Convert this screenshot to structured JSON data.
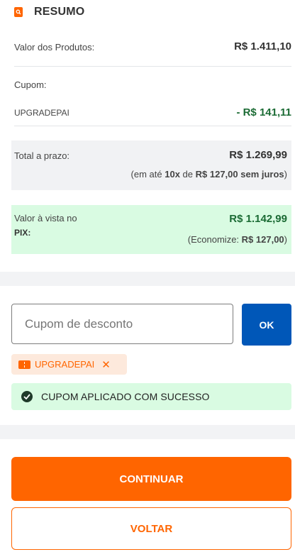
{
  "summary": {
    "title": "RESUMO",
    "icon": "search-receipt-icon",
    "products_label": "Valor dos Produtos:",
    "products_value": "R$ 1.411,10",
    "coupon_label": "Cupom:",
    "coupon_code": "UPGRADEPAI",
    "coupon_discount": "- R$ 141,11",
    "total_label": "Total a prazo:",
    "total_value": "R$ 1.269,99",
    "installments": {
      "prefix": "(em até ",
      "count": "10x",
      "mid": " de ",
      "amount": "R$ 127,00 sem juros",
      "suffix": ")"
    },
    "pix_label": "Valor à vista no",
    "pix_label_strong": "PIX:",
    "pix_value": "R$ 1.142,99",
    "savings": {
      "prefix": "(Economize: ",
      "amount": "R$ 127,00",
      "suffix": ")"
    }
  },
  "coupon": {
    "placeholder": "Cupom de desconto",
    "ok_label": "OK",
    "applied_code": "UPGRADEPAI",
    "remove_symbol": "✕",
    "success_message": "CUPOM APLICADO COM SUCESSO"
  },
  "actions": {
    "continue_label": "CONTINUAR",
    "back_label": "VOLTAR"
  },
  "colors": {
    "accent": "#ff6500",
    "primary_blue": "#0057b8",
    "discount_green": "#1b6b34",
    "success_bg": "#d9fbe2"
  }
}
